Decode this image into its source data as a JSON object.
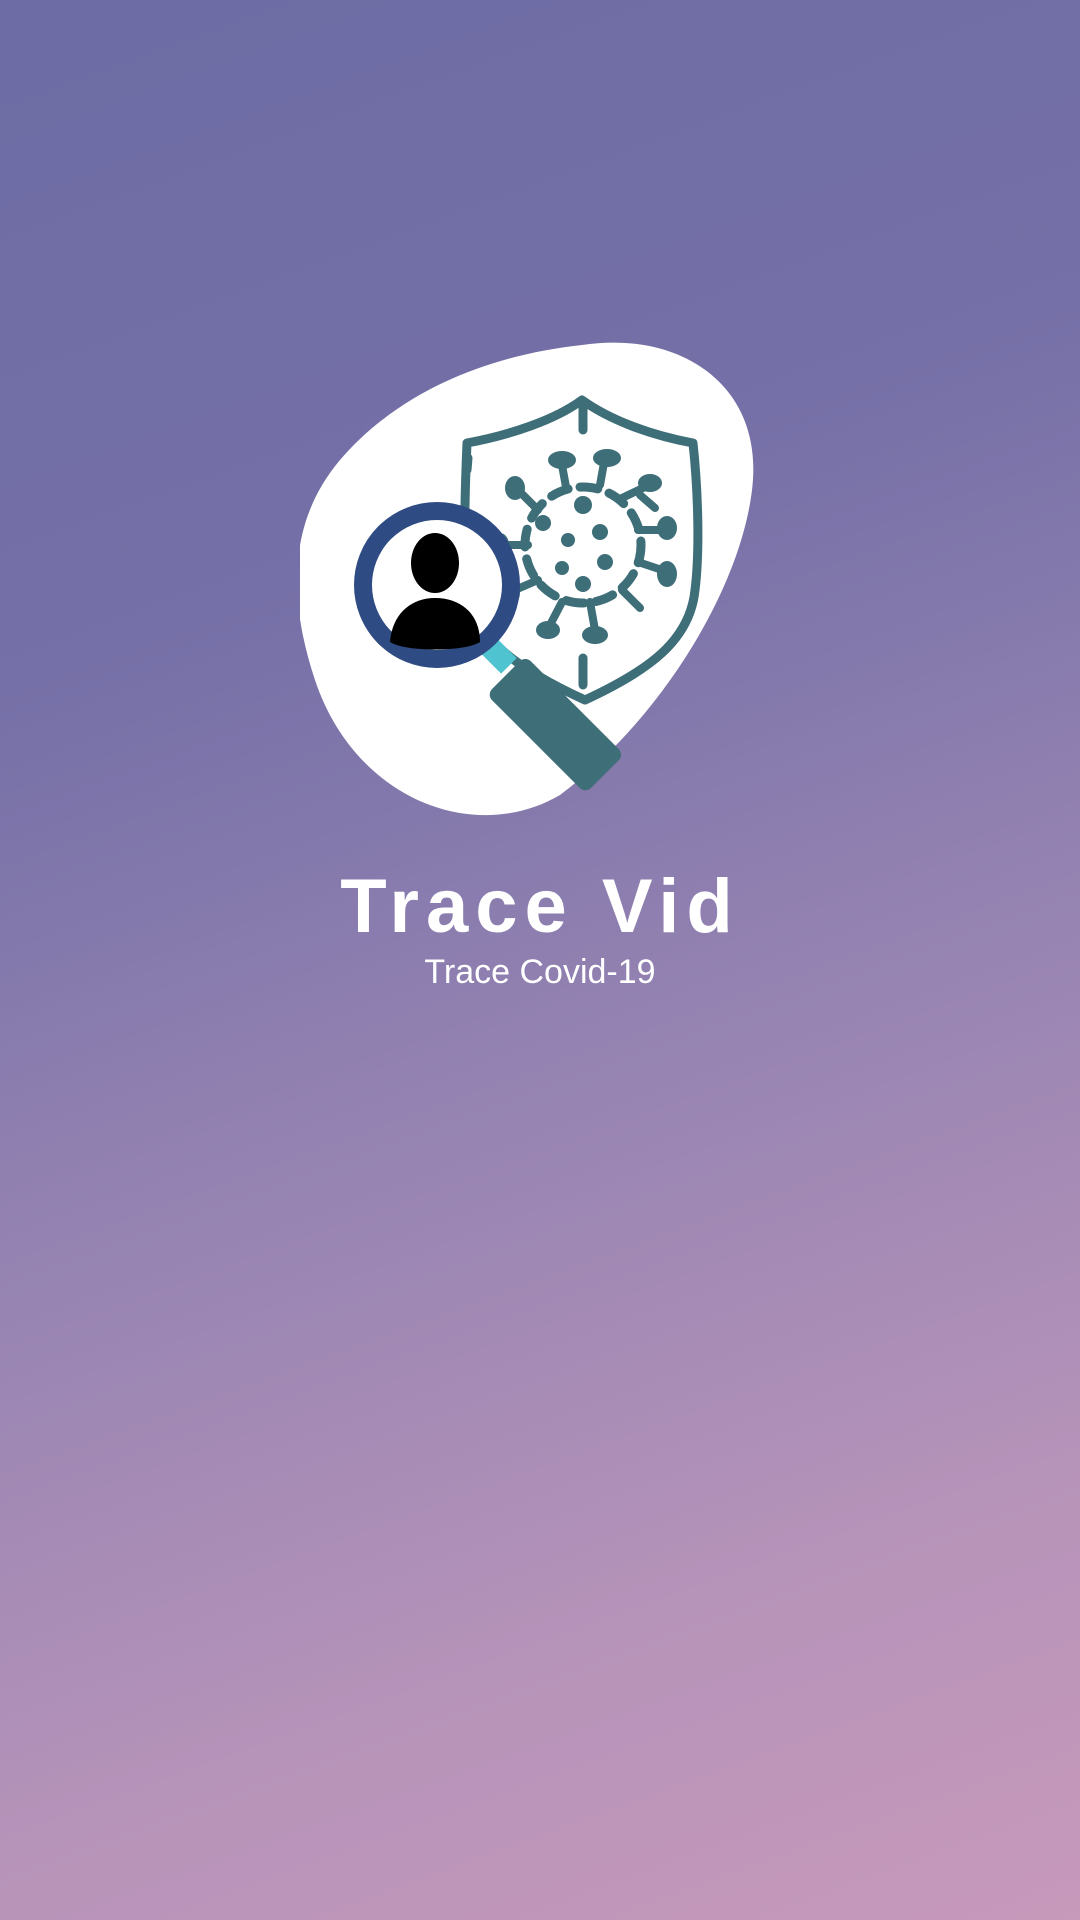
{
  "app": {
    "title": "Trace Vid",
    "subtitle": "Trace Covid-19"
  },
  "logo": {
    "icons": [
      "shield-icon",
      "virus-icon",
      "magnifier-icon",
      "person-icon"
    ]
  },
  "colors": {
    "background_top": "#6d6ca4",
    "background_bottom": "#c799bb",
    "blob": "#ffffff",
    "shield_teal": "#3e6e78",
    "magnifier_ring": "#2f4b83",
    "magnifier_neck": "#4fc3d0",
    "person": "#000000",
    "text": "#ffffff"
  }
}
